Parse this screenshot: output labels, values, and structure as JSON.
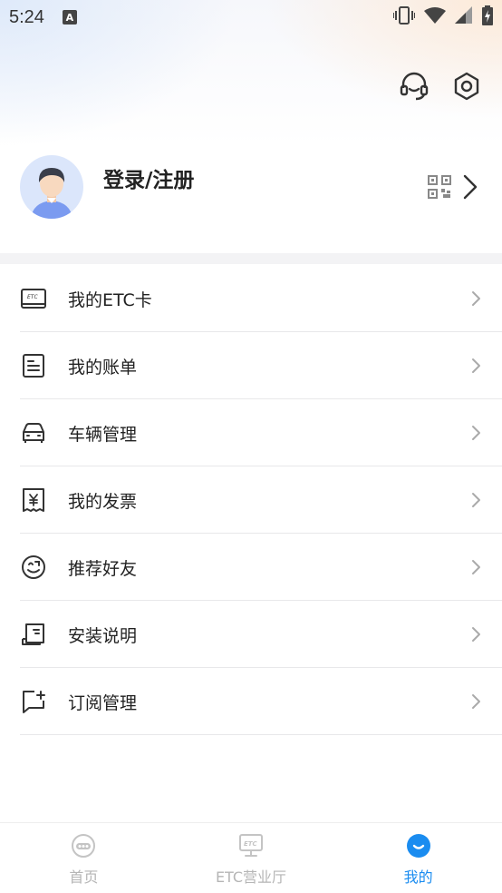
{
  "status_bar": {
    "time": "5:24",
    "notif_letter": "A"
  },
  "header": {
    "icons": [
      "headset-icon",
      "settings-icon"
    ]
  },
  "profile": {
    "login_label": "登录/注册"
  },
  "menu": {
    "items": [
      {
        "label": "我的ETC卡",
        "icon": "etc-card-icon"
      },
      {
        "label": "我的账单",
        "icon": "bill-icon"
      },
      {
        "label": "车辆管理",
        "icon": "car-icon"
      },
      {
        "label": "我的发票",
        "icon": "invoice-icon"
      },
      {
        "label": "推荐好友",
        "icon": "recommend-icon"
      },
      {
        "label": "安装说明",
        "icon": "install-guide-icon"
      },
      {
        "label": "订阅管理",
        "icon": "subscribe-icon"
      }
    ]
  },
  "tabbar": {
    "tabs": [
      {
        "label": "首页",
        "icon": "home-icon"
      },
      {
        "label": "ETC营业厅",
        "icon": "etc-hall-icon"
      },
      {
        "label": "我的",
        "icon": "mine-icon"
      }
    ],
    "active_color": "#1a8cf0",
    "inactive_color": "#b5b5b5"
  }
}
